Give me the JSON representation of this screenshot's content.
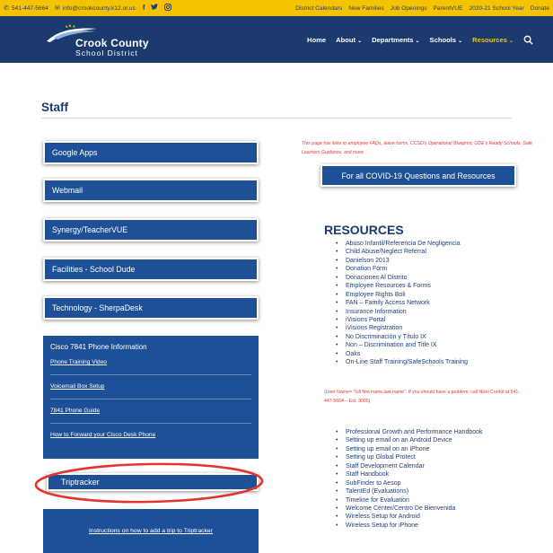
{
  "topbar": {
    "phone": "541-447-5664",
    "email": "info@crookcounty.k12.or.us",
    "social": [
      "f",
      "t",
      "o"
    ],
    "links": [
      "District Calendars",
      "New Families",
      "Job Openings",
      "ParentVUE",
      "2020-21 School Year",
      "Donate"
    ]
  },
  "logo": {
    "name": "Crook County",
    "sub": "School District"
  },
  "nav": {
    "items": [
      {
        "label": "Home",
        "chevron": ""
      },
      {
        "label": "About",
        "chevron": "⌄"
      },
      {
        "label": "Departments",
        "chevron": "⌄"
      },
      {
        "label": "Schools",
        "chevron": "⌄"
      },
      {
        "label": "Resources",
        "chevron": "⌄"
      }
    ],
    "active_color": "#f5c200"
  },
  "page": {
    "title": "Staff"
  },
  "left_buttons": [
    "Google Apps",
    "Webmail",
    "Synergy/TeacherVUE",
    "Facilities - School Dude",
    "Technology - SherpaDesk"
  ],
  "cisco": {
    "title": "Cisco 7841 Phone Information",
    "links": [
      "Phone Training Video",
      "Voicemail Box Setup",
      "7841 Phone Guide",
      "How to Forward your Cisco Desk Phone"
    ]
  },
  "triptracker": {
    "label": "Triptracker",
    "instructions": "Instructions on how to add a trip to Triptracker"
  },
  "right": {
    "note": "This page has links to employee FAQs, leave forms, CCSD's Operational Blueprint, ODE's Ready Schools, Safe Learners Guidance, and more.",
    "covid_button": "For all COVID-19 Questions and Resources",
    "resources_heading": "RESOURCES",
    "resources": [
      "Abuso Infantil/Referencia De Negligencia",
      "Child Abuse/Neglect Referral",
      "Danielson 2013",
      "Donation Form",
      "Donaciones Al Distrito",
      "Employee Resources & Forms",
      "Employee Rights Boli",
      "FAN – Family Access Network",
      "Insurance Information",
      "iVisions Portal",
      "iVisions Registration",
      "No Discriminación y Título IX",
      "Non – Discrimination and Title IX",
      "Oaks",
      "On-Line Staff Training/SafeSchools Training"
    ],
    "user_note": "(User Name= \"full first name.last name\". If you should have a problem, call Nikki Cordol at 541-447-5664 – Ext. 3005)",
    "resources2": [
      "Professional Growth and Performance Handbook",
      "Setting up email on an Android Device",
      "Setting up email on an iPhone",
      "Setting up Global Protect",
      "Staff Development Calendar",
      "Staff Handbook",
      "SubFinder to Aesop",
      "TalentEd (Evaluations)",
      "Timeline for Evaluation",
      "Welcome Center/Centro De Bienvenida",
      "Wireless Setup for Android",
      "Wireless Setup for iPhone"
    ]
  },
  "colors": {
    "navy": "#1b3a6e",
    "button_blue": "#1d5096",
    "gold": "#f5c200",
    "annotation_red": "#e3342f"
  }
}
